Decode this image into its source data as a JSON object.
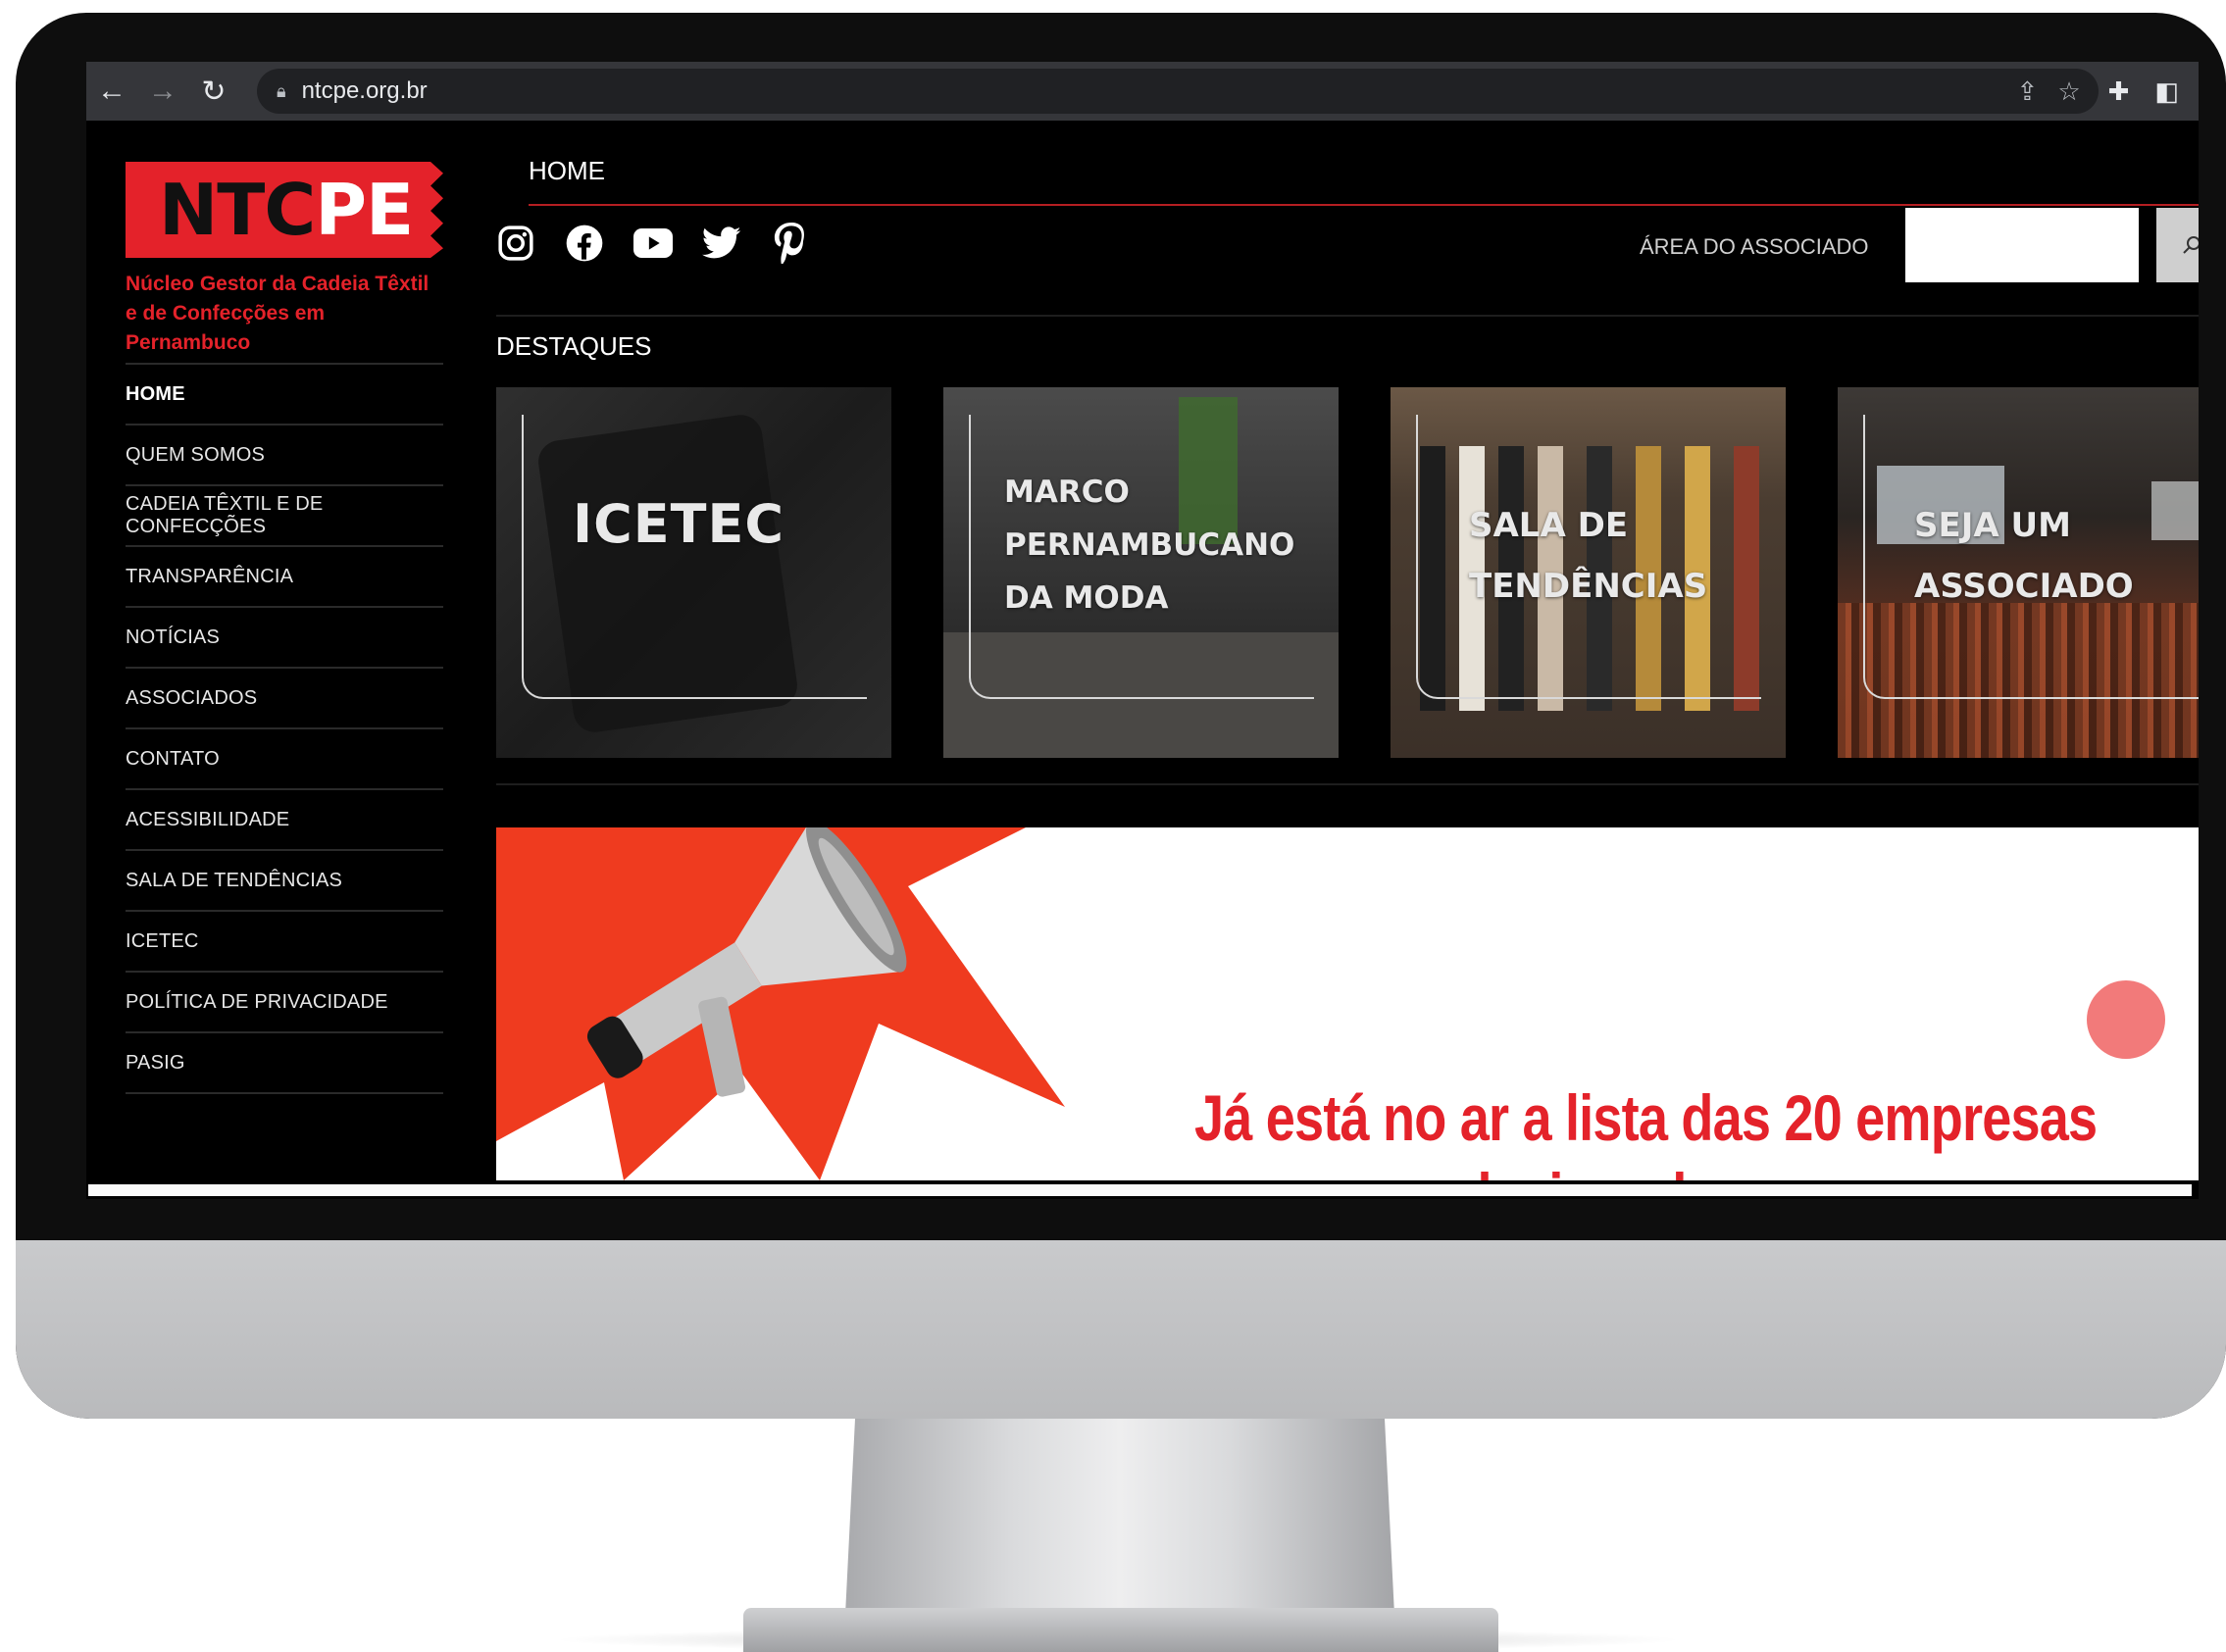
{
  "browser": {
    "url": "ntcpe.org.br"
  },
  "logo": {
    "part1": "NTC",
    "part2": "PE",
    "subtitle_line1": "Núcleo Gestor da Cadeia Têxtil",
    "subtitle_line2": "e de Confecções em Pernambuco"
  },
  "sidebar": {
    "items": [
      {
        "label": "HOME",
        "active": true
      },
      {
        "label": "QUEM SOMOS"
      },
      {
        "label": "CADEIA TÊXTIL E DE CONFECÇÕES"
      },
      {
        "label": "TRANSPARÊNCIA"
      },
      {
        "label": "NOTÍCIAS"
      },
      {
        "label": "ASSOCIADOS"
      },
      {
        "label": "CONTATO"
      },
      {
        "label": "ACESSIBILIDADE"
      },
      {
        "label": "SALA DE TENDÊNCIAS"
      },
      {
        "label": "ICETEC"
      },
      {
        "label": "POLÍTICA DE PRIVACIDADE"
      },
      {
        "label": "PASIG"
      }
    ]
  },
  "header": {
    "nav_home": "HOME",
    "area_associado": "ÁREA DO ASSOCIADO",
    "social_icons": [
      "instagram-icon",
      "facebook-icon",
      "youtube-icon",
      "twitter-icon",
      "pinterest-icon"
    ]
  },
  "main": {
    "section_title": "DESTAQUES",
    "cards": [
      {
        "title_lines": [
          "ICETEC"
        ]
      },
      {
        "title_lines": [
          "MARCO",
          "PERNAMBUCANO",
          "DA MODA"
        ]
      },
      {
        "title_lines": [
          "SALA DE",
          "TENDÊNCIAS"
        ]
      },
      {
        "title_lines": [
          "SEJA UM",
          "ASSOCIADO"
        ]
      }
    ],
    "banner": {
      "headline": "Já está no ar a lista das 20 empresas",
      "headline_cont": "selecionadas para"
    }
  },
  "colors": {
    "brand_red": "#e4222a",
    "background": "#000000",
    "nav_divider": "#2a2a2a"
  }
}
